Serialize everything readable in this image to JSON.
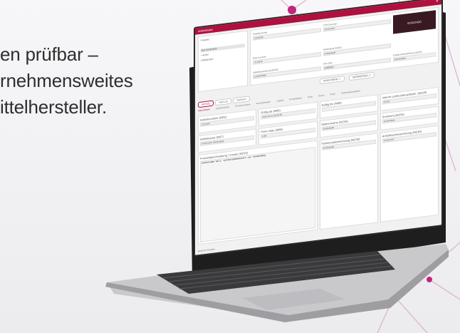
{
  "marketing": {
    "line1": "en prüfbar –",
    "line2": "rnehmensweites",
    "line3": "ittelhersteller."
  },
  "app": {
    "window_title": "Artikeldaten",
    "close_label": "✕",
    "tree": {
      "items": [
        "Produkte",
        "",
        "SKB Schokolade",
        "+ Artikel",
        "Artikelgruppe"
      ]
    },
    "fields": [
      {
        "label": "Projektnummer",
        "value": "12345abc"
      },
      {
        "label": "EAN-Nummer",
        "value": "4712345"
      },
      {
        "label": "Artikelbezeichnung (M230)",
        "value": "1234567890"
      },
      {
        "label": "GTIN-Nummer",
        "value": "SYNCHOC"
      },
      {
        "label": "Artikelname (M230)",
        "value": "Schokolade"
      },
      {
        "label": "SPO-GMI",
        "value": "28888884"
      },
      {
        "label": "Funktionsbezeichnung (M230)",
        "value": "Schokolade"
      }
    ],
    "thumb_label": "SYNCHOC",
    "buttons": {
      "save": "SPEICHERN ☉",
      "discard": "VERWERFEN ☉"
    },
    "tabs": [
      "ARTIKEL",
      "MODULE",
      "VERSION"
    ],
    "subtabs": [
      "Stammdaten",
      "Zutaten/Daten",
      "Prozessvariante",
      "Ausschüttewert",
      "Logistik",
      "Produktdaten",
      "Preis",
      "Import",
      "Pulse",
      "Temperaturangaben"
    ],
    "cells": [
      {
        "label": "Artikelnummer (M01)",
        "value": "1234456"
      },
      {
        "label": "Gültig ab (M05)",
        "value": "2016-01-01  09:00:00"
      },
      {
        "label": "Gültig bis (M06)",
        "value": ""
      },
      {
        "label": "Interne Lieferantenartikelnr. (M229)",
        "value": "87234"
      },
      {
        "label": "Artikelname (M07)",
        "value": "SYNCHOC Schokolade"
      },
      {
        "label": "Preis netto (M08)",
        "value": "0,89"
      },
      {
        "label": "Markenname (M234)",
        "value": "Schokolade"
      },
      {
        "label": "Sortiment (M235)",
        "value": "Schokolade"
      }
    ],
    "description": {
      "label": "Produktbeschreibung / Zusatz (M233)",
      "value": "Schokolade hell, schokoladenbasiert zur Verwendung"
    },
    "label_a": {
      "label": "Funktionsbezeichnung (M230)",
      "value": "Schokolade"
    },
    "label_b": {
      "label": "Artikelkurzbezeichnung (M230)",
      "value": "SYNCHOC"
    },
    "status": "Bereit für Eingabe"
  },
  "colors": {
    "accent": "#b10f3d",
    "deco": "#d23a8c"
  }
}
